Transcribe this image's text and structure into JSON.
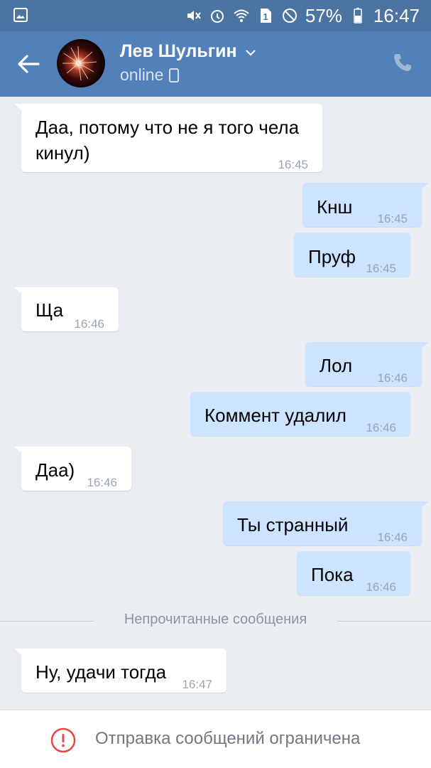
{
  "statusbar": {
    "battery": "57%",
    "time": "16:47",
    "icons": [
      "gallery-icon",
      "mute-icon",
      "alarm-icon",
      "wifi-icon",
      "sim-1-icon",
      "do-not-disturb-icon",
      "battery-icon"
    ]
  },
  "header": {
    "name": "Лев Шульгин",
    "status": "online"
  },
  "messages": [
    {
      "dir": "in",
      "text": "Даа, потому что не я того чела\nкинул)",
      "time": "16:45"
    },
    {
      "dir": "out",
      "text": "Кнш",
      "time": "16:45"
    },
    {
      "dir": "out",
      "text": "Пруф",
      "time": "16:45"
    },
    {
      "dir": "in",
      "text": "Ща",
      "time": "16:46"
    },
    {
      "dir": "out",
      "text": "Лол",
      "time": "16:46"
    },
    {
      "dir": "out",
      "text": "Коммент удалил",
      "time": "16:46"
    },
    {
      "dir": "in",
      "text": "Даа)",
      "time": "16:46"
    },
    {
      "dir": "out",
      "text": "Ты странный",
      "time": "16:46"
    },
    {
      "dir": "out",
      "text": "Пока",
      "time": "16:46"
    },
    {
      "dir": "in",
      "text": "Ну, удачи тогда",
      "time": "16:47"
    }
  ],
  "divider": {
    "label": "Непрочитанные сообщения"
  },
  "footer": {
    "text": "Отправка сообщений ограничена"
  },
  "colors": {
    "header": "#5181b8",
    "statusbar": "#4c74a3",
    "incoming": "#ffffff",
    "outgoing": "#cce4ff",
    "background": "#eaeef3",
    "warning": "#e64646"
  }
}
